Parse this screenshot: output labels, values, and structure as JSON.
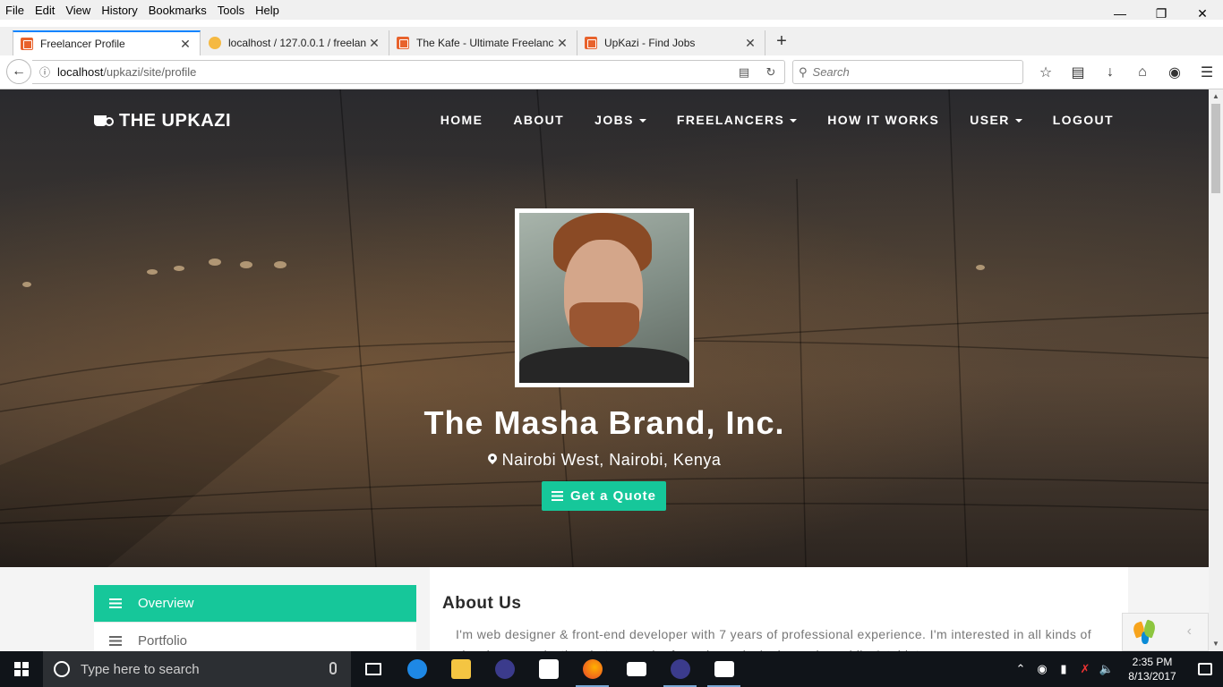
{
  "browser": {
    "menu": [
      "File",
      "Edit",
      "View",
      "History",
      "Bookmarks",
      "Tools",
      "Help"
    ],
    "tabs": [
      {
        "label": "Freelancer Profile",
        "active": true
      },
      {
        "label": "localhost / 127.0.0.1 / freelan",
        "active": false
      },
      {
        "label": "The Kafe - Ultimate Freelanc",
        "active": false
      },
      {
        "label": "UpKazi - Find Jobs",
        "active": false
      }
    ],
    "url_host": "localhost",
    "url_path": "/upkazi/site/profile",
    "search_placeholder": "Search"
  },
  "site": {
    "brand": "THE UPKAZI",
    "menu": [
      {
        "label": "HOME",
        "dropdown": false
      },
      {
        "label": "ABOUT",
        "dropdown": false
      },
      {
        "label": "JOBS",
        "dropdown": true
      },
      {
        "label": "FREELANCERS",
        "dropdown": true
      },
      {
        "label": "HOW IT WORKS",
        "dropdown": false
      },
      {
        "label": "USER",
        "dropdown": true
      },
      {
        "label": "LOGOUT",
        "dropdown": false
      }
    ]
  },
  "profile": {
    "name": "The Masha Brand, Inc.",
    "location": "Nairobi West, Nairobi, Kenya",
    "quote_button": "Get a Quote"
  },
  "sidebar": {
    "items": [
      {
        "label": "Overview",
        "active": true
      },
      {
        "label": "Portfolio",
        "active": false
      }
    ]
  },
  "about": {
    "heading": "About Us",
    "text": "I'm web designer & front-end developer with 7 years of professional experience. I'm interested in all kinds of visual communication, but my major focus is on designing web, mobile & tablet"
  },
  "taskbar": {
    "search_placeholder": "Type here to search",
    "time": "2:35 PM",
    "date": "8/13/2017"
  },
  "colors": {
    "accent": "#16c79a",
    "browser_tab_accent": "#0a84ff",
    "taskbar": "#101419"
  }
}
